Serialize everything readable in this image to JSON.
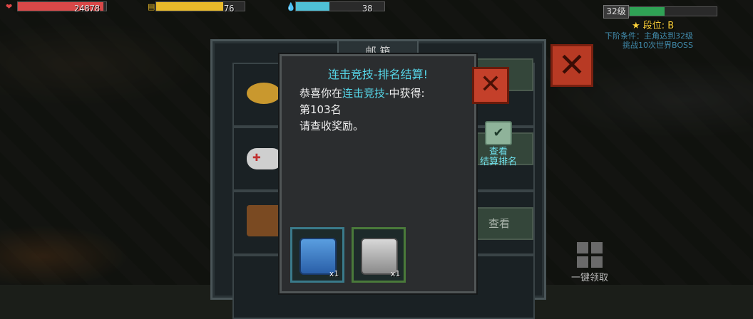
{
  "hud": {
    "health": {
      "value": "24878",
      "fill": 0.97,
      "color": "#d94848",
      "icon": "heart-icon"
    },
    "energy": {
      "value": "76",
      "fill": 0.76,
      "color": "#e8b92a",
      "icon": "battery-icon"
    },
    "water": {
      "value": "38",
      "fill": 0.38,
      "color": "#4fc0d6",
      "icon": "water-drop-icon"
    },
    "level": "32级",
    "exp_fill": 0.4,
    "rank_label": "段位: B"
  },
  "quest": {
    "line1": "下阶条件：主角达到32级",
    "line2": "挑战10次世界BOSS"
  },
  "mailbox": {
    "title": "邮 箱",
    "view_label": "查看",
    "rank_view": {
      "line1": "查看",
      "line2": "结算排名"
    },
    "one_key": "一键领取"
  },
  "dialog": {
    "title": "连击竞技-排名结算!",
    "line1_pre": "恭喜你在",
    "line1_hl": "连击竞技-",
    "line1_post": "中获得:",
    "line2": "第103名",
    "line3": "请查收奖励。",
    "rewards": [
      {
        "name": "blue-supply-crate",
        "count": "x1"
      },
      {
        "name": "gray-supply-crate",
        "count": "x1"
      }
    ]
  }
}
